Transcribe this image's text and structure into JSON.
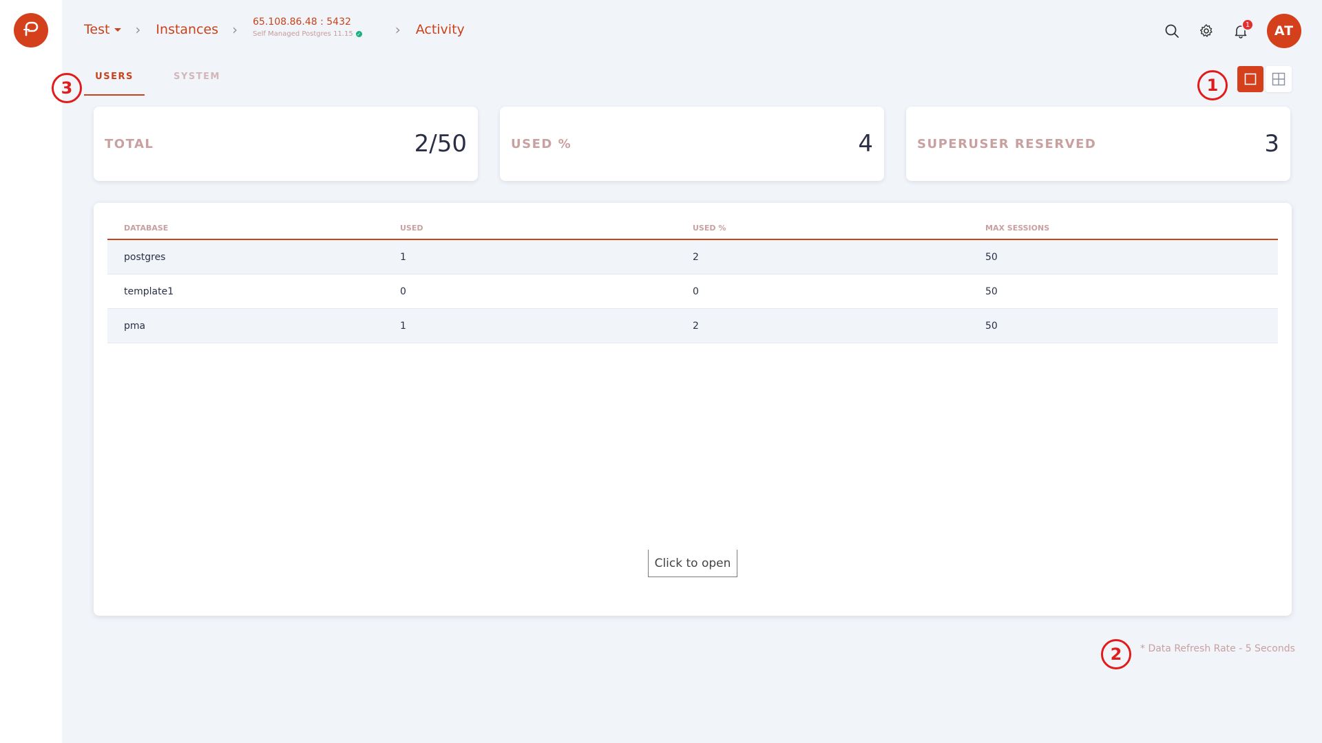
{
  "breadcrumb": {
    "project": "Test",
    "instances": "Instances",
    "instance_address": "65.108.86.48 : 5432",
    "instance_type": "Self Managed Postgres 11.15",
    "current": "Activity"
  },
  "header": {
    "notification_count": "1",
    "avatar_initials": "AT"
  },
  "tabs": [
    {
      "label": "USERS",
      "active": true
    },
    {
      "label": "SYSTEM",
      "active": false
    }
  ],
  "stats": [
    {
      "label": "TOTAL",
      "value": "2/50"
    },
    {
      "label": "USED %",
      "value": "4"
    },
    {
      "label": "SUPERUSER RESERVED",
      "value": "3"
    }
  ],
  "table": {
    "columns": [
      "DATABASE",
      "USED",
      "USED %",
      "MAX SESSIONS"
    ],
    "rows": [
      [
        "postgres",
        "1",
        "2",
        "50"
      ],
      [
        "template1",
        "0",
        "0",
        "50"
      ],
      [
        "pma",
        "1",
        "2",
        "50"
      ]
    ]
  },
  "tooltip": "Click to open",
  "footer": {
    "refresh_note": "* Data Refresh Rate - 5 Seconds"
  },
  "markers": [
    "1",
    "2",
    "3"
  ],
  "colors": {
    "accent": "#d4401c",
    "marker": "#e01b1b",
    "background": "#f1f4f9"
  }
}
